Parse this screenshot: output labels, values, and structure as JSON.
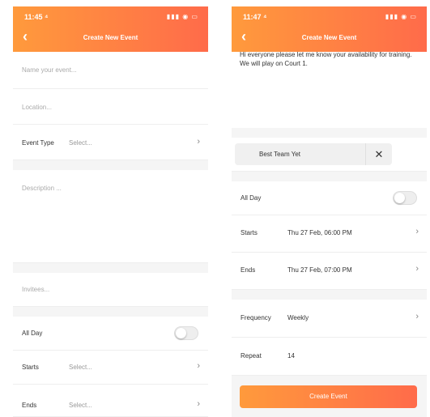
{
  "screen1": {
    "status_time": "11:45 ⁴",
    "status_icons": "▮▮▮ ◉ ▭",
    "back_icon": "‹",
    "title": "Create New Event",
    "name_placeholder": "Name your event...",
    "location_placeholder": "Location...",
    "event_type_label": "Event Type",
    "event_type_value": "Select...",
    "description_placeholder": "Description ...",
    "invitees_placeholder": "Invitees...",
    "all_day_label": "All Day",
    "starts_label": "Starts",
    "starts_value": "Select...",
    "ends_label": "Ends",
    "ends_value": "Select...",
    "chevron": "›"
  },
  "screen2": {
    "status_time": "11:47 ⁴",
    "status_icons": "▮▮▮ ◉ ▭",
    "back_icon": "‹",
    "title": "Create New Event",
    "description_text": "Hi everyone please let me know your availability for training. We will play on Court 1.",
    "invitee_chip": "Best Team Yet",
    "chip_remove": "✕",
    "all_day_label": "All Day",
    "starts_label": "Starts",
    "starts_value": "Thu 27 Feb, 06:00 PM",
    "ends_label": "Ends",
    "ends_value": "Thu 27 Feb, 07:00 PM",
    "frequency_label": "Frequency",
    "frequency_value": "Weekly",
    "repeat_label": "Repeat",
    "repeat_value": "14",
    "create_button": "Create Event",
    "chevron": "›"
  },
  "colors": {
    "accent_start": "#ff9a3c",
    "accent_end": "#ff6b4a"
  }
}
